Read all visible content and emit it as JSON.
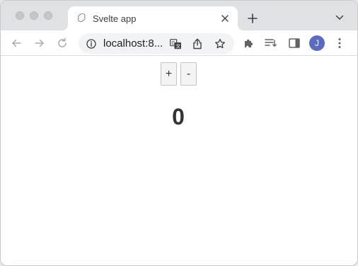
{
  "colors": {
    "tabstrip_bg": "#dfe1e5",
    "omnibox_bg": "#f1f3f4",
    "avatar_bg": "#5c6bc0",
    "icon_color": "#5f6368"
  },
  "browser": {
    "tab": {
      "title": "Svelte app",
      "favicon": "svelte-logo"
    },
    "omnibox": {
      "url_display": "localhost:8..."
    },
    "avatar_initial": "J",
    "icons": [
      "back-arrow-icon",
      "forward-arrow-icon",
      "reload-icon",
      "info-icon",
      "translate-icon",
      "share-icon",
      "bookmark-star-icon",
      "extensions-puzzle-icon",
      "reading-list-icon",
      "side-panel-icon",
      "more-vert-icon",
      "new-tab-plus-icon",
      "tab-search-chevron-icon",
      "tab-close-icon"
    ]
  },
  "app": {
    "increment_label": "+",
    "decrement_label": "-",
    "count": "0"
  }
}
